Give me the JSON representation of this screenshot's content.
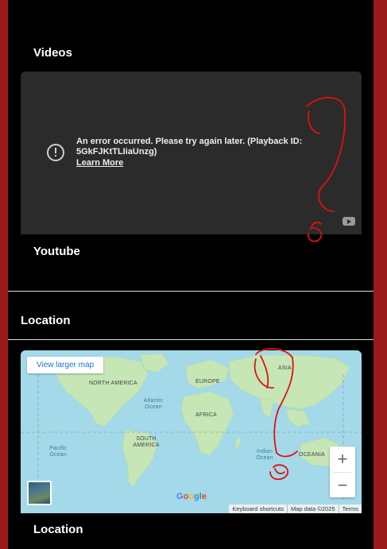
{
  "sections": {
    "videos_heading": "Videos",
    "youtube_caption": "Youtube",
    "location_heading": "Location",
    "location_caption": "Location"
  },
  "video": {
    "error_message": "An error occurred. Please try again later. (Playback ID: 5GkFJKtTLIiaUnzg)",
    "learn_more": "Learn More",
    "icons": [
      "error-icon",
      "youtube-icon"
    ]
  },
  "map": {
    "view_larger": "View larger map",
    "zoom_in": "+",
    "zoom_out": "−",
    "google": "Google",
    "labels": {
      "north_america": "NORTH AMERICA",
      "south_america": "SOUTH AMERICA",
      "europe": "EUROPE",
      "africa": "AFRICA",
      "asia": "ASIA",
      "oceania": "OCEANIA",
      "atlantic": "Atlantic Ocean",
      "pacific": "Pacific Ocean",
      "indian": "Indian Ocean"
    },
    "attribution": {
      "shortcuts": "Keyboard shortcuts",
      "data": "Map data ©2025",
      "terms": "Terms"
    }
  },
  "colors": {
    "page_border": "#9b1b1b",
    "panel": "#000000",
    "video_bg": "#2b2b2b",
    "ocean": "#a4d9ea",
    "land": "#c6e6b5",
    "annotation": "#e01010"
  }
}
